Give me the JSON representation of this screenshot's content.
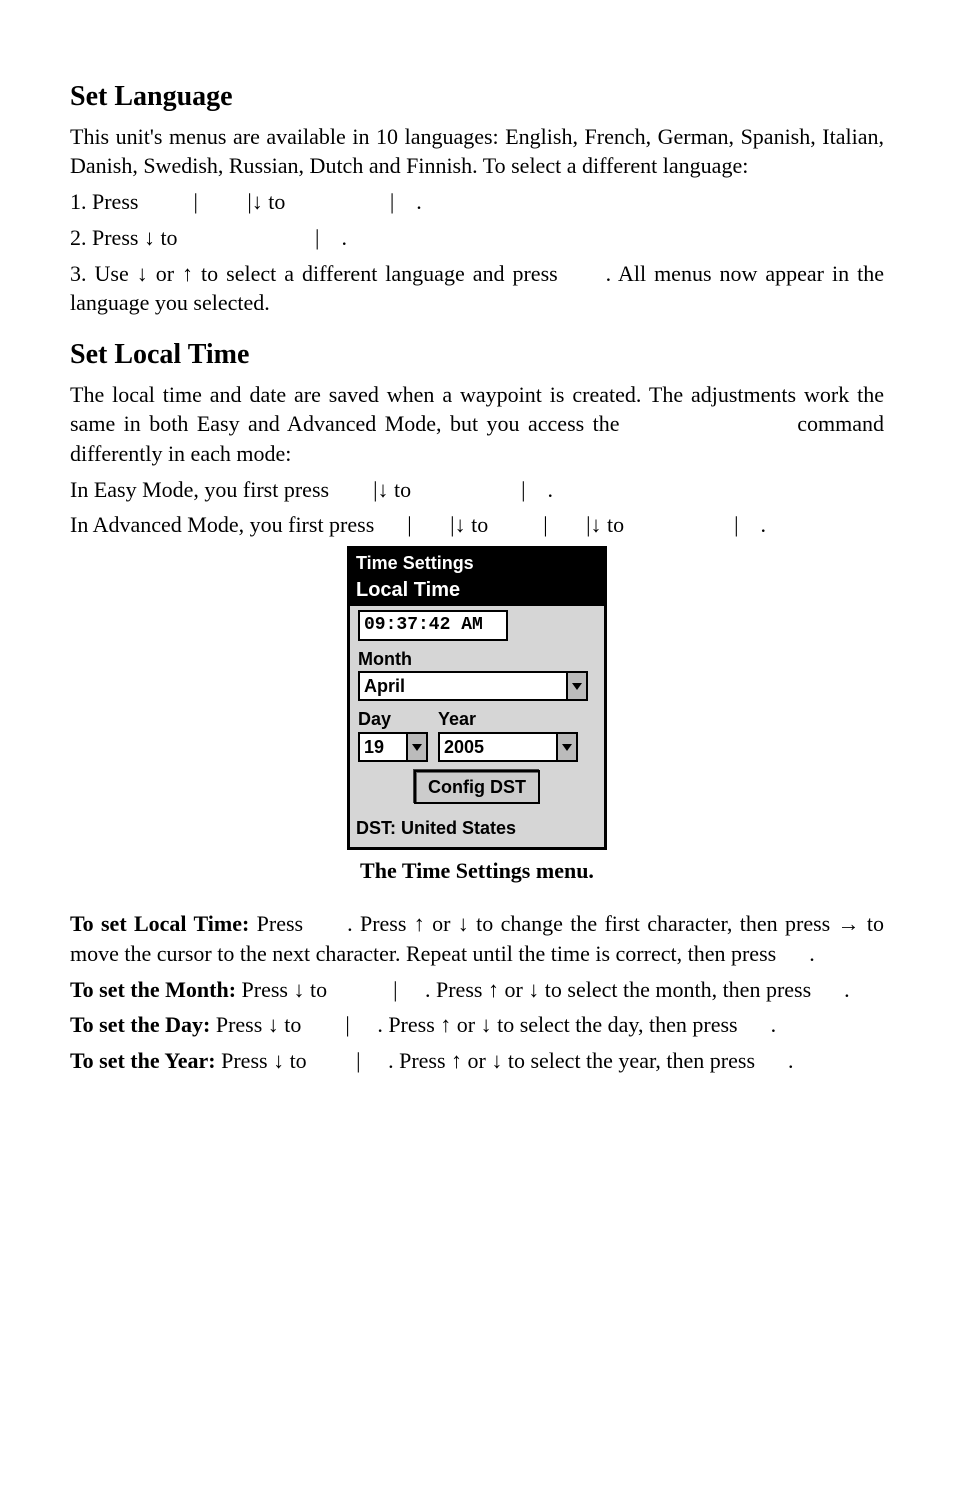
{
  "h1": "Set Language",
  "p1": "This unit's menus are available in 10 languages: English, French, German, Spanish, Italian, Danish, Swedish, Russian, Dutch and Finnish. To select a different language:",
  "s1": "1. Press          |         |↓ to                   |    .",
  "s2": "2. Press ↓ to                         |    .",
  "s3": "3. Use ↓ or ↑ to select a different language and press      . All menus now appear in the language you selected.",
  "h2": "Set Local Time",
  "p3": "The local time and date are saved when a waypoint is created. The adjustments work the same in both Easy and Advanced Mode, but you access the                     command differently in each mode:",
  "p4": "In Easy Mode, you first press        |↓ to                    |    .",
  "p5": "In Advanced Mode, you first press      |       |↓ to          |       |↓ to                    |    .",
  "device": {
    "title": "Time Settings",
    "section": "Local Time",
    "time": "09:37:42 AM",
    "monthLabel": "Month",
    "month": "April",
    "dayLabel": "Day",
    "day": "19",
    "yearLabel": "Year",
    "year": "2005",
    "button": "Config DST",
    "dst": "DST: United States"
  },
  "caption": "The Time Settings menu.",
  "lt": {
    "b": "To set Local Time:",
    "t": " Press      . Press ↑ or ↓ to change the first character, then press → to move the cursor to the next character. Repeat until the time is correct, then press      ."
  },
  "mo": {
    "b": "To set the Month:",
    "t": " Press ↓ to            |     . Press ↑ or ↓ to select the month, then press      ."
  },
  "da": {
    "b": "To set the Day:",
    "t": " Press ↓ to        |     . Press ↑ or ↓ to select the day, then press      ."
  },
  "yr": {
    "b": "To set the Year:",
    "t": " Press ↓ to         |     . Press ↑ or ↓ to select the year, then press      ."
  }
}
